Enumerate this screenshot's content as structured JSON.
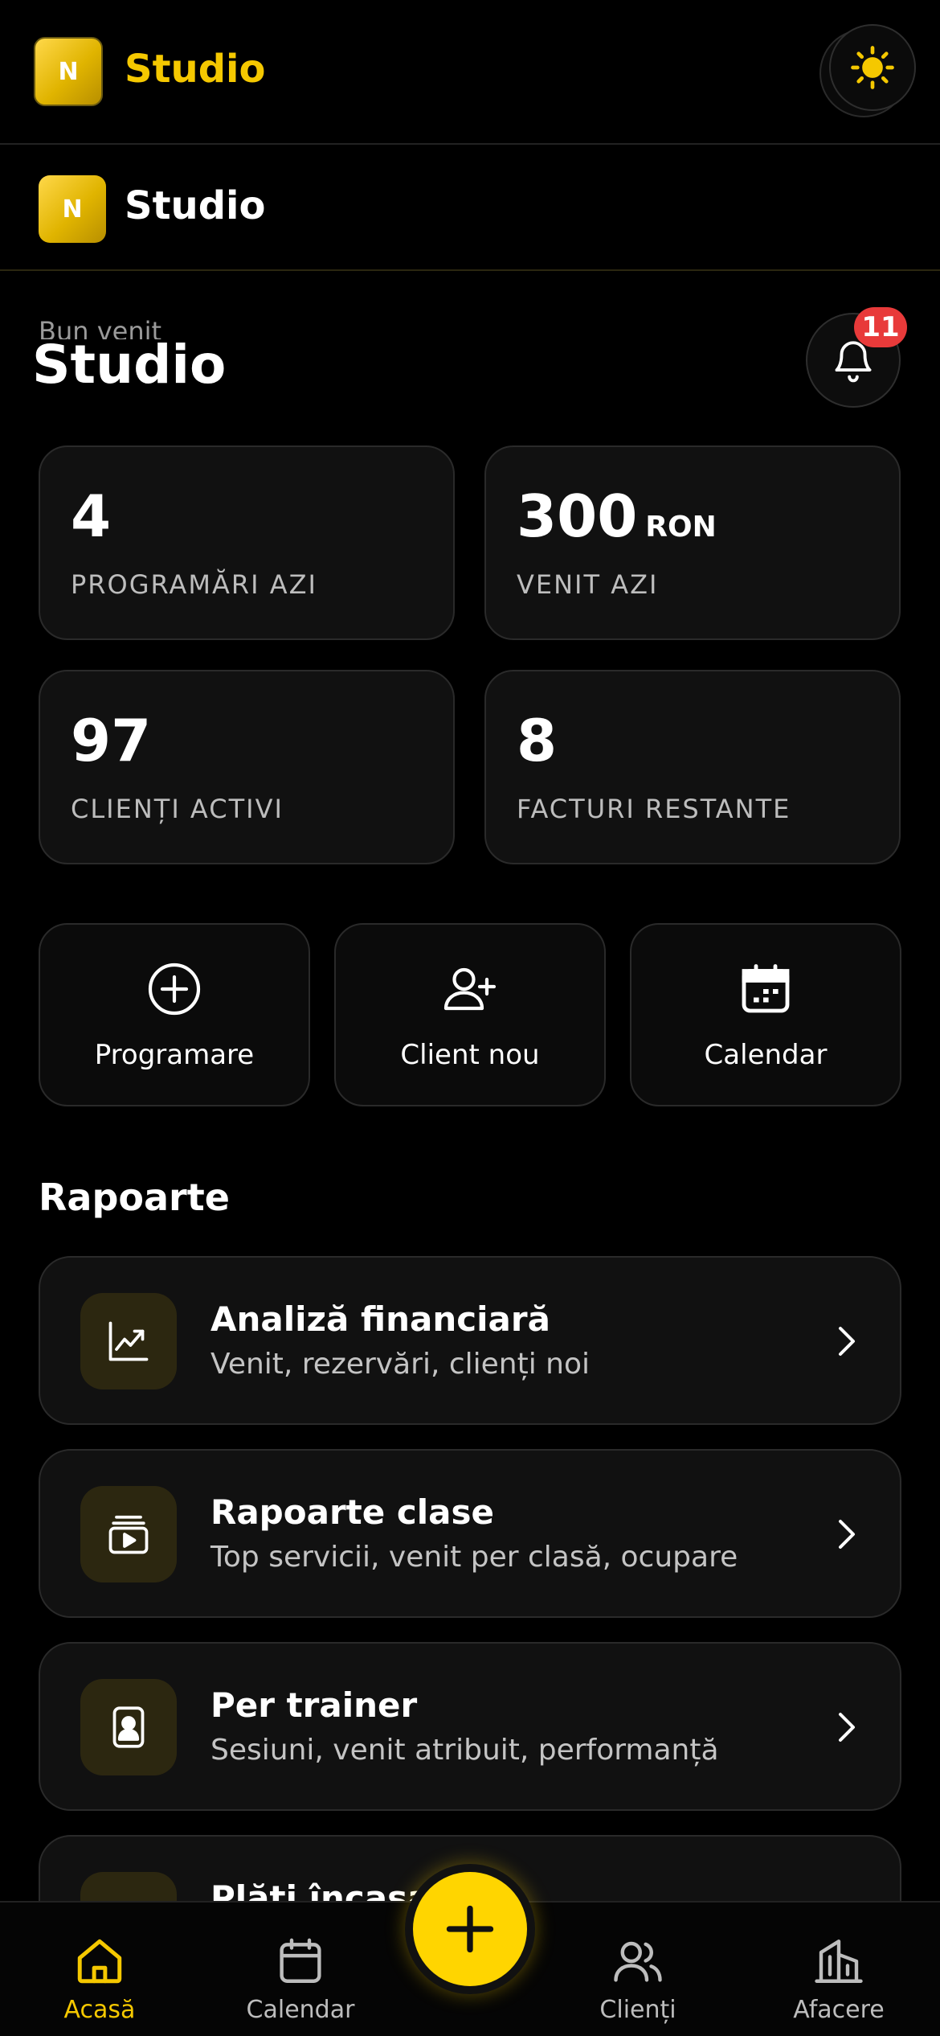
{
  "colors": {
    "accent": "#f5c800",
    "background": "#000000",
    "card": "#111111",
    "badge": "#e83a3a",
    "icon_box": "#2c2710"
  },
  "header": {
    "logo_letter": "N",
    "title": "Studio",
    "theme_icon": "sun-icon"
  },
  "subheader": {
    "logo_letter": "N",
    "title": "Studio"
  },
  "greeting": {
    "small": "Bun venit",
    "name": "Studio",
    "notification_count": "11",
    "notification_icon": "bell-icon"
  },
  "stats": [
    {
      "value": "4",
      "unit": "",
      "label": "PROGRAMĂRI AZI"
    },
    {
      "value": "300",
      "unit": "RON",
      "label": "VENIT AZI"
    },
    {
      "value": "97",
      "unit": "",
      "label": "CLIENȚI ACTIVI"
    },
    {
      "value": "8",
      "unit": "",
      "label": "FACTURI RESTANTE"
    }
  ],
  "actions": [
    {
      "label": "Programare",
      "icon": "plus-circle-icon"
    },
    {
      "label": "Client nou",
      "icon": "user-plus-icon"
    },
    {
      "label": "Calendar",
      "icon": "calendar-icon"
    }
  ],
  "reports": {
    "title": "Rapoarte",
    "items": [
      {
        "title": "Analiză financiară",
        "subtitle": "Venit, rezervări, clienți noi",
        "icon": "chart-line-icon"
      },
      {
        "title": "Rapoarte clase",
        "subtitle": "Top servicii, venit per clasă, ocupare",
        "icon": "class-play-icon"
      },
      {
        "title": "Per trainer",
        "subtitle": "Sesiuni, venit atribuit, performanță",
        "icon": "trainer-badge-icon"
      },
      {
        "title": "Plăți încasate",
        "subtitle": "",
        "icon": "payment-icon"
      }
    ]
  },
  "bottom_nav": {
    "items": [
      {
        "label": "Acasă",
        "icon": "home-icon"
      },
      {
        "label": "Calendar",
        "icon": "calendar-icon"
      },
      {
        "label": "Clienți",
        "icon": "users-icon"
      },
      {
        "label": "Afacere",
        "icon": "building-icon"
      }
    ],
    "fab_icon": "plus-icon"
  }
}
